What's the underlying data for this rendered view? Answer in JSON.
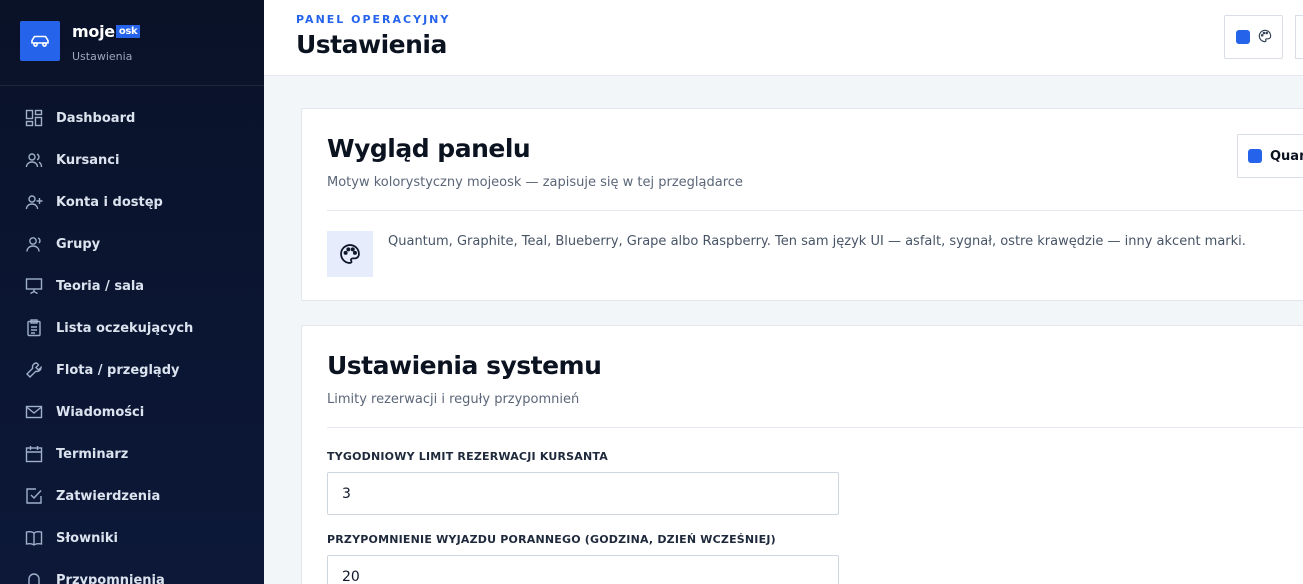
{
  "brand": {
    "name": "moje",
    "tag": "osk",
    "subtitle": "Ustawienia"
  },
  "sidebar": {
    "items": [
      {
        "label": "Dashboard",
        "icon": "dashboard-grid-icon"
      },
      {
        "label": "Kursanci",
        "icon": "users-icon"
      },
      {
        "label": "Konta i dostęp",
        "icon": "user-plus-icon"
      },
      {
        "label": "Grupy",
        "icon": "user-group-icon"
      },
      {
        "label": "Teoria / sala",
        "icon": "presentation-icon"
      },
      {
        "label": "Lista oczekujących",
        "icon": "clipboard-list-icon"
      },
      {
        "label": "Flota / przeglądy",
        "icon": "wrench-icon"
      },
      {
        "label": "Wiadomości",
        "icon": "mail-icon"
      },
      {
        "label": "Terminarz",
        "icon": "calendar-icon"
      },
      {
        "label": "Zatwierdzenia",
        "icon": "check-square-icon"
      },
      {
        "label": "Słowniki",
        "icon": "book-icon"
      },
      {
        "label": "Przypomnienia",
        "icon": "bell-icon"
      }
    ]
  },
  "header": {
    "eyebrow": "PANEL OPERACYJNY",
    "title": "Ustawienia"
  },
  "appearance": {
    "title": "Wygląd panelu",
    "subtitle": "Motyw kolorystyczny mojeosk — zapisuje się w tej przeglądarce",
    "theme_select_value": "Quantum",
    "description": "Quantum, Graphite, Teal, Blueberry, Grape albo Raspberry. Ten sam język UI — asfalt, sygnał, ostre krawędzie — inny akcent marki."
  },
  "system": {
    "title": "Ustawienia systemu",
    "subtitle": "Limity rezerwacji i reguły przypomnień",
    "fields": [
      {
        "label": "TYGODNIOWY LIMIT REZERWACJI KURSANTA",
        "value": "3"
      },
      {
        "label": "PRZYPOMNIENIE WYJAZDU PORANNEGO (GODZINA, DZIEŃ WCZEŚNIEJ)",
        "value": "20"
      }
    ]
  },
  "colors": {
    "accent": "#2563eb",
    "sidebar_bg": "#0a1228"
  }
}
